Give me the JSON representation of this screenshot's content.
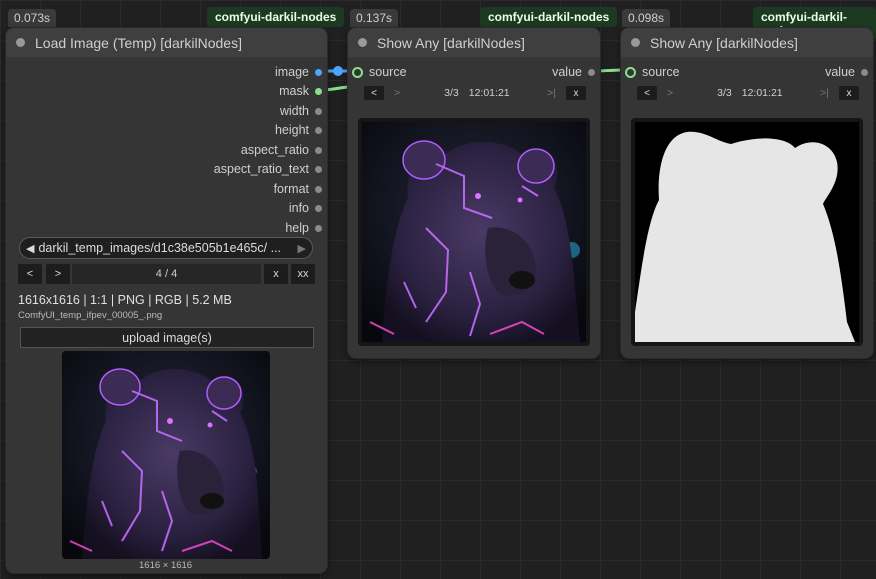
{
  "colors": {
    "accent_blue": "#4ea5ff",
    "accent_green": "#8ae08a",
    "pack_badge": "#1c3a22"
  },
  "nodes": {
    "load": {
      "time": "0.073s",
      "pack": "comfyui-darkil-nodes",
      "title": "Load Image (Temp) [darkilNodes]",
      "outputs": [
        "image",
        "mask",
        "width",
        "height",
        "aspect_ratio",
        "aspect_ratio_text",
        "format",
        "info",
        "help"
      ],
      "combo_value": "darkil_temp_images/d1c38e505b1e465c/ ...",
      "prev_label": "<",
      "next_label": ">",
      "page": "4 / 4",
      "x_label": "x",
      "xx_label": "xx",
      "info_line": "1616x1616 | 1:1 | PNG | RGB | 5.2 MB",
      "filename": "ComfyUI_temp_ifpev_00005_.png",
      "upload_label": "upload image(s)",
      "preview_caption": "1616 × 1616"
    },
    "show1": {
      "time": "0.137s",
      "pack": "comfyui-darkil-nodes",
      "title": "Show Any [darkilNodes]",
      "input": "source",
      "output": "value",
      "prev_label": "<",
      "next_label": ">",
      "index": "3/3",
      "clock": "12:01:21",
      "last_label": ">|",
      "close_label": "x"
    },
    "show2": {
      "time": "0.098s",
      "pack": "comfyui-darkil-nodes",
      "title": "Show Any [darkilNodes]",
      "input": "source",
      "output": "value",
      "prev_label": "<",
      "next_label": ">",
      "index": "3/3",
      "clock": "12:01:21",
      "last_label": ">|",
      "close_label": "x"
    }
  }
}
